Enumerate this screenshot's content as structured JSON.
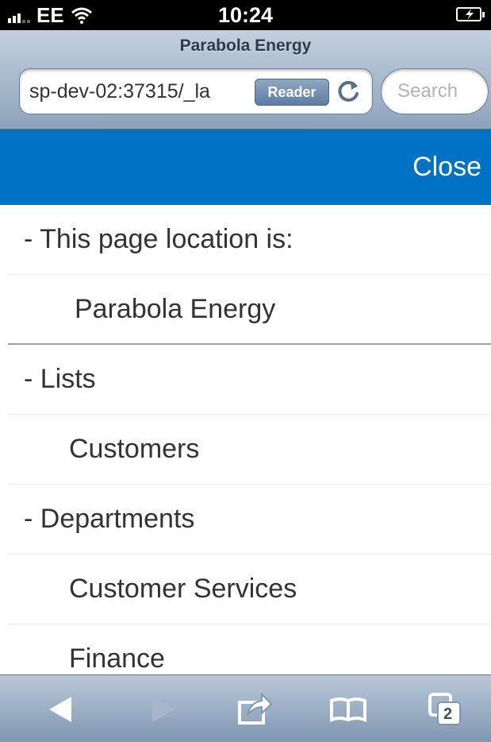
{
  "status_bar": {
    "carrier": "EE",
    "time": "10:24"
  },
  "browser": {
    "page_title": "Parabola Energy",
    "url": "sp-dev-02:37315/_la",
    "reader_label": "Reader",
    "search_placeholder": "Search"
  },
  "header": {
    "close_label": "Close",
    "background_color": "#0072c6"
  },
  "nav": {
    "location_heading": "- This page location is:",
    "location_item": "Parabola Energy",
    "lists_heading": "- Lists",
    "lists_item": "Customers",
    "departments_heading": "- Departments",
    "departments_items": [
      "Customer Services",
      "Finance"
    ]
  },
  "toolbar": {
    "tabs_count": "2",
    "icons": [
      "back-icon",
      "forward-icon",
      "share-icon",
      "bookmarks-icon",
      "tabs-icon"
    ]
  }
}
